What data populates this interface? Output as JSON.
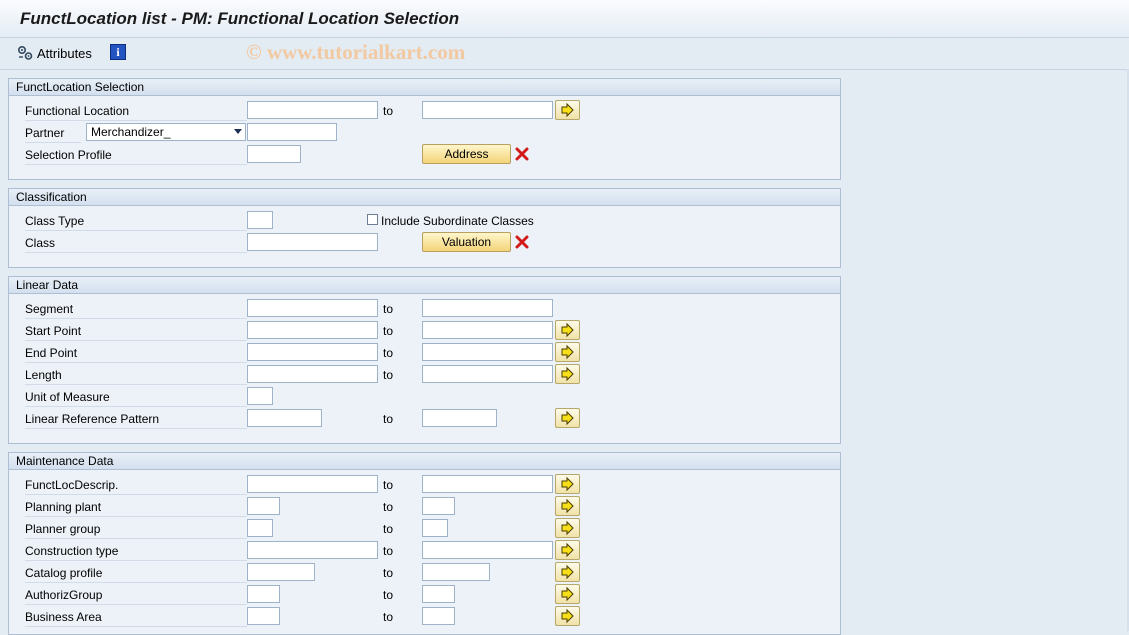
{
  "title": "FunctLocation list - PM: Functional Location Selection",
  "toolbar": {
    "attributes_label": "Attributes",
    "info_label": "i"
  },
  "watermark": "© www.tutorialkart.com",
  "common": {
    "to": "to"
  },
  "sections": {
    "selection": {
      "header": "FunctLocation Selection",
      "functional_location": "Functional Location",
      "partner": "Partner",
      "partner_select": "Merchandizer_",
      "selection_profile": "Selection Profile",
      "address_button": "Address"
    },
    "classification": {
      "header": "Classification",
      "class_type": "Class Type",
      "include_subordinate": "Include Subordinate Classes",
      "class": "Class",
      "valuation_button": "Valuation"
    },
    "linear": {
      "header": "Linear Data",
      "segment": "Segment",
      "start_point": "Start Point",
      "end_point": "End Point",
      "length": "Length",
      "unit_of_measure": "Unit of Measure",
      "linear_reference_pattern": "Linear Reference Pattern"
    },
    "maintenance": {
      "header": "Maintenance Data",
      "funct_loc_descrip": "FunctLocDescrip.",
      "planning_plant": "Planning plant",
      "planner_group": "Planner group",
      "construction_type": "Construction type",
      "catalog_profile": "Catalog profile",
      "authoriz_group": "AuthorizGroup",
      "business_area": "Business Area"
    }
  },
  "colors": {
    "background": "#e3ebf3",
    "group_box": "#edf2f8",
    "button_yellow": "#f3d479",
    "delete_red": "#d21a1a"
  },
  "icons": {
    "attributes": "attributes-icon",
    "info": "info-icon",
    "multiple_selection": "arrow-right-icon",
    "delete": "delete-x-icon"
  }
}
